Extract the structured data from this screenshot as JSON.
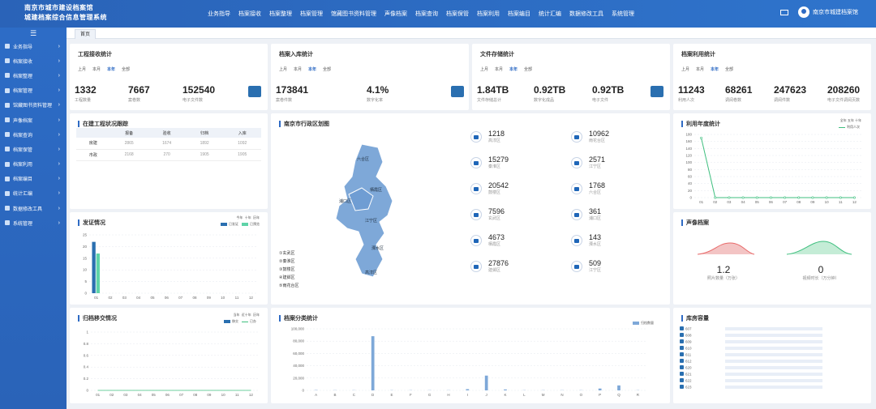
{
  "app": {
    "title_line1": "南京市城市建设档案馆",
    "title_line2": "城建档案综合信息管理系统",
    "user": "南京市城建档案馆"
  },
  "nav": [
    "业务指导",
    "档案接收",
    "档案整理",
    "档案管理",
    "馆藏图书资料管理",
    "声像档案",
    "档案查询",
    "档案保管",
    "档案利用",
    "档案编目",
    "统计汇编",
    "数据修改工具",
    "系统管理"
  ],
  "sidebar": [
    "业务指导",
    "档案接收",
    "档案整理",
    "档案管理",
    "馆藏图书资料管理",
    "声像档案",
    "档案查询",
    "档案保管",
    "档案利用",
    "档案编目",
    "统计汇编",
    "数据修改工具",
    "系统管理"
  ],
  "tab": "首页",
  "periods": [
    "上月",
    "本月",
    "本年",
    "全部"
  ],
  "engineering": {
    "title": "工程接收统计",
    "stats": [
      {
        "v": "1332",
        "l": "工程数量"
      },
      {
        "v": "7667",
        "l": "案卷数"
      },
      {
        "v": "152540",
        "l": "电子文件数"
      }
    ]
  },
  "archive_in": {
    "title": "档案入库统计",
    "stats": [
      {
        "v": "173841",
        "l": "案卷件数"
      },
      {
        "v": "4.1%",
        "l": "数字化率"
      }
    ]
  },
  "file_storage": {
    "title": "文件存储统计",
    "stats": [
      {
        "v": "1.84TB",
        "l": "文件存储总计"
      },
      {
        "v": "0.92TB",
        "l": "数字化成品"
      },
      {
        "v": "0.92TB",
        "l": "电子文件"
      }
    ]
  },
  "archive_use": {
    "title": "档案利用统计",
    "stats": [
      {
        "v": "11243",
        "l": "利用人次"
      },
      {
        "v": "68261",
        "l": "调阅卷数"
      },
      {
        "v": "247623",
        "l": "调阅件数"
      },
      {
        "v": "208260",
        "l": "电子文件调阅页数"
      }
    ]
  },
  "tracking": {
    "title": "在建工程状况跟踪",
    "headers": [
      "",
      "报备",
      "验收",
      "归档",
      "入库"
    ],
    "rows": [
      [
        "房建",
        "2865",
        "1674",
        "1892",
        "1092"
      ],
      [
        "市政",
        "2168",
        "270",
        "1905",
        "1905"
      ]
    ]
  },
  "map": {
    "title": "南京市行政区划图",
    "labels": [
      "六合区",
      "浦口区",
      "栖霞区",
      "江宁区",
      "溧水区",
      "高淳区"
    ],
    "districts": [
      "①玄武区",
      "②秦淮区",
      "③鼓楼区",
      "④建邺区",
      "⑤雨花台区"
    ],
    "items": [
      {
        "v": "1218",
        "l": "高淳区"
      },
      {
        "v": "10962",
        "l": "雨花台区"
      },
      {
        "v": "15279",
        "l": "秦淮区"
      },
      {
        "v": "2571",
        "l": "江宁区"
      },
      {
        "v": "20542",
        "l": "鼓楼区"
      },
      {
        "v": "1768",
        "l": "六合区"
      },
      {
        "v": "7596",
        "l": "玄武区"
      },
      {
        "v": "361",
        "l": "浦口区"
      },
      {
        "v": "4673",
        "l": "栖霞区"
      },
      {
        "v": "143",
        "l": "溧水区"
      },
      {
        "v": "27876",
        "l": "建邺区"
      },
      {
        "v": "509",
        "l": "江宁区"
      }
    ]
  },
  "colors": {
    "primary": "#2a63b8",
    "series1": "#2a6fb0",
    "series2": "#5ed3a8",
    "accent_red": "#e86a6a",
    "accent_green": "#3fbf7f"
  },
  "charts": {
    "yearly_use": {
      "title": "利用年度统计",
      "tabs": [
        "全年",
        "五年",
        "十年"
      ],
      "legend": "利用人次"
    },
    "issuance": {
      "title": "发证情况",
      "tabs": [
        "今年",
        "十年",
        "历年"
      ],
      "legend": [
        "已发证",
        "已预览"
      ]
    },
    "transfer": {
      "title": "归档移交情况",
      "tabs": [
        "当年",
        "近十年",
        "历年"
      ],
      "legend": [
        "移交",
        "已办"
      ]
    },
    "classification": {
      "title": "档案分类统计",
      "legend": "归档数量"
    },
    "audio": {
      "title": "声像档案",
      "a_v": "1.2",
      "a_l": "照片数量（万张）",
      "b_v": "0",
      "b_l": "视频时长（万分钟）"
    },
    "storage": {
      "title": "库房容量"
    }
  },
  "chart_data": [
    {
      "type": "line",
      "title": "利用年度统计",
      "x": [
        "01",
        "02",
        "03",
        "04",
        "05",
        "06",
        "07",
        "08",
        "09",
        "10",
        "11",
        "12"
      ],
      "ylim": [
        0,
        180
      ],
      "yticks": [
        0,
        20,
        40,
        60,
        80,
        100,
        120,
        140,
        160,
        180
      ],
      "series": [
        {
          "name": "利用人次",
          "values": [
            170,
            0,
            0,
            0,
            0,
            0,
            0,
            0,
            0,
            0,
            0,
            0
          ]
        }
      ]
    },
    {
      "type": "bar",
      "title": "发证情况",
      "categories": [
        "01",
        "02",
        "03",
        "04",
        "05",
        "06",
        "07",
        "08",
        "09",
        "10",
        "11",
        "12"
      ],
      "ylim": [
        0,
        25
      ],
      "yticks": [
        0,
        5,
        10,
        15,
        20,
        25
      ],
      "series": [
        {
          "name": "已发证",
          "values": [
            22,
            0,
            0,
            0,
            0,
            0,
            0,
            0,
            0,
            0,
            0,
            0
          ]
        },
        {
          "name": "已预览",
          "values": [
            17,
            0,
            0,
            0,
            0,
            0,
            0,
            0,
            0,
            0,
            0,
            0
          ]
        }
      ]
    },
    {
      "type": "bar",
      "title": "归档移交情况",
      "categories": [
        "01",
        "02",
        "03",
        "04",
        "05",
        "06",
        "07",
        "08",
        "09",
        "10",
        "11",
        "12"
      ],
      "ylim": [
        0,
        1
      ],
      "yticks": [
        0,
        0.2,
        0.4,
        0.6,
        0.8,
        1
      ],
      "series": [
        {
          "name": "移交",
          "values": [
            0,
            0,
            0,
            0,
            0,
            0,
            0,
            0,
            0,
            0,
            0,
            0
          ]
        },
        {
          "name": "已办",
          "values": [
            0,
            0,
            0,
            0,
            0,
            0,
            0,
            0,
            0,
            0,
            0,
            0
          ]
        }
      ]
    },
    {
      "type": "bar",
      "title": "档案分类统计",
      "categories": [
        "A",
        "B",
        "C",
        "D",
        "E",
        "F",
        "G",
        "H",
        "I",
        "J",
        "K",
        "L",
        "M",
        "N",
        "O",
        "P",
        "Q",
        "R"
      ],
      "ylim": [
        0,
        100000
      ],
      "yticks": [
        0,
        20000,
        40000,
        60000,
        80000,
        100000
      ],
      "series": [
        {
          "name": "归档数量",
          "values": [
            500,
            300,
            300,
            88000,
            300,
            300,
            300,
            300,
            2000,
            24000,
            1500,
            300,
            300,
            300,
            300,
            3000,
            8000,
            300
          ]
        }
      ]
    },
    {
      "type": "bar",
      "title": "库房容量",
      "categories": [
        "607",
        "608",
        "609",
        "610",
        "611",
        "612",
        "620",
        "621",
        "622",
        "623"
      ],
      "series": [
        {
          "values": [
            0.6,
            0.6,
            0.6,
            0.6,
            0.6,
            0.6,
            0.6,
            0.6,
            0.6,
            0.6
          ]
        }
      ]
    }
  ]
}
